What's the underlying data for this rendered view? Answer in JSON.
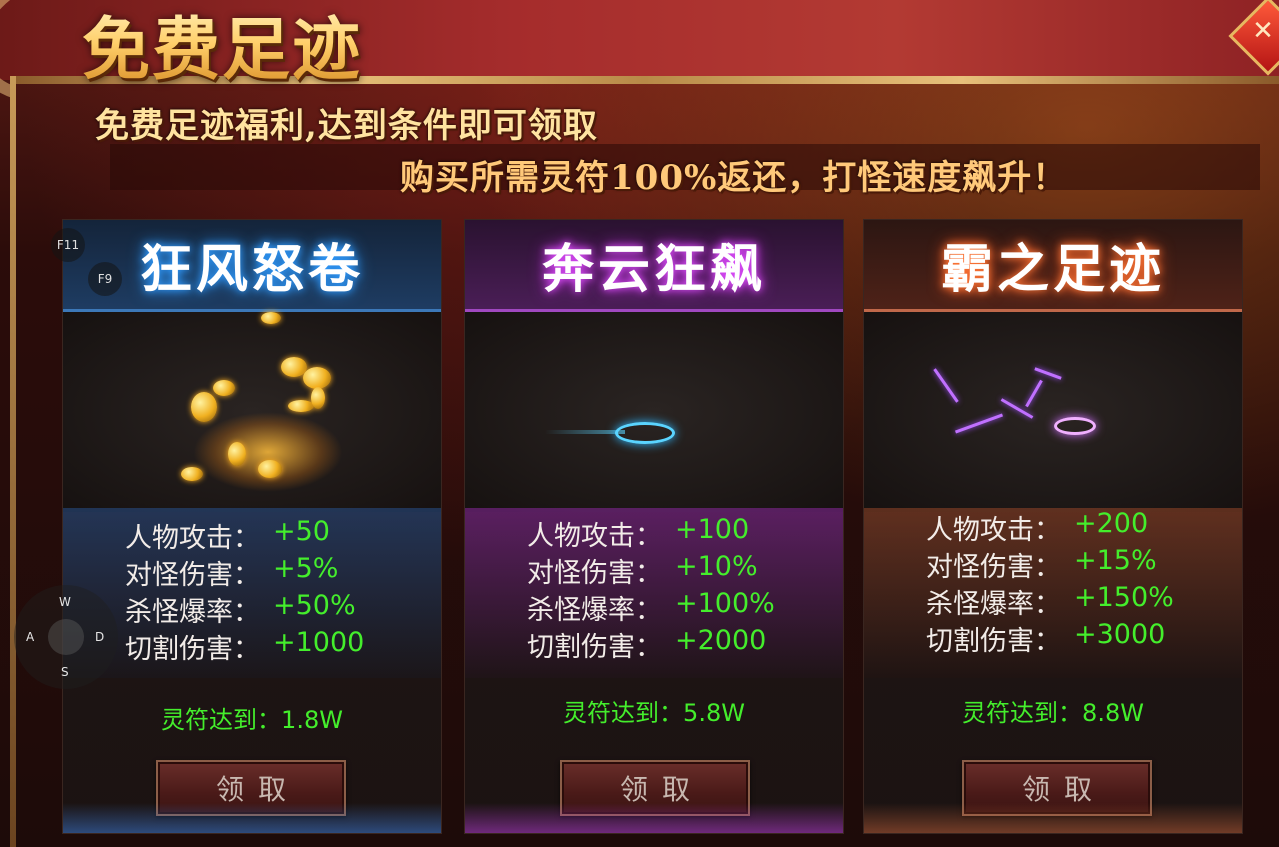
{
  "header": {
    "title": "免费足迹",
    "close_icon": "close-icon",
    "subtitle_line1": "免费足迹福利,达到条件即可领取",
    "subtitle_line2": "购买所需灵符100%返还，打怪速度飙升！"
  },
  "cards": [
    {
      "title": "狂风怒卷",
      "accent": "#2f9bff",
      "art_icon": "gold-coins-footprint-icon",
      "stats": [
        {
          "label": "人物攻击：",
          "value": "+50"
        },
        {
          "label": "对怪伤害：",
          "value": "+5%"
        },
        {
          "label": "杀怪爆率：",
          "value": "+50%"
        },
        {
          "label": "切割伤害：",
          "value": "+1000"
        }
      ],
      "requirement": "灵符达到：1.8W",
      "button_label": "领取"
    },
    {
      "title": "奔云狂飙",
      "accent": "#e050ff",
      "art_icon": "blue-footprint-icon",
      "stats": [
        {
          "label": "人物攻击：",
          "value": "+100"
        },
        {
          "label": "对怪伤害：",
          "value": "+10%"
        },
        {
          "label": "杀怪爆率：",
          "value": "+100%"
        },
        {
          "label": "切割伤害：",
          "value": "+2000"
        }
      ],
      "requirement": "灵符达到：5.8W",
      "button_label": "领取"
    },
    {
      "title": "霸之足迹",
      "accent": "#ff7a3a",
      "art_icon": "lightning-footprint-icon",
      "stats": [
        {
          "label": "人物攻击：",
          "value": "+200"
        },
        {
          "label": "对怪伤害：",
          "value": "+15%"
        },
        {
          "label": "杀怪爆率：",
          "value": "+150%"
        },
        {
          "label": "切割伤害：",
          "value": "+3000"
        }
      ],
      "requirement": "灵符达到：8.8W",
      "button_label": "领取"
    }
  ],
  "overlay": {
    "hotkeys": [
      "F11",
      "F9"
    ],
    "joystick_keys": {
      "up": "W",
      "left": "A",
      "right": "D",
      "down": "S"
    }
  },
  "colors": {
    "stat_value": "#44ee2c",
    "title_gold": "#ffd98a"
  }
}
